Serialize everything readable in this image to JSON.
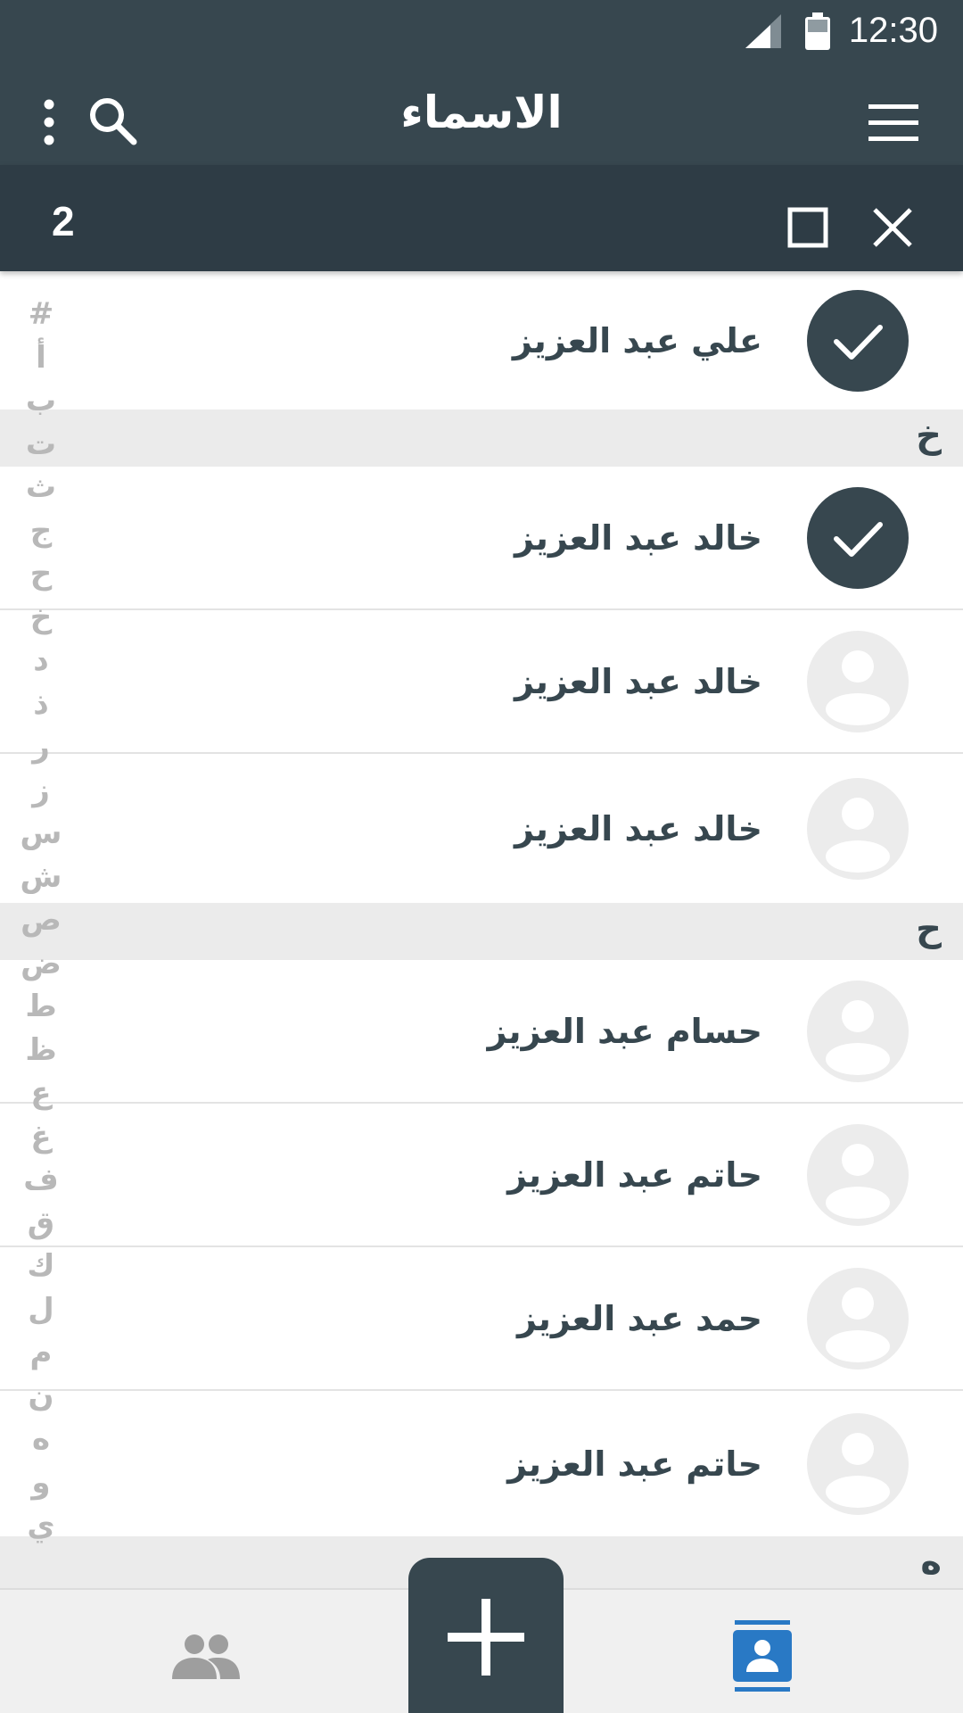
{
  "status_bar": {
    "time": "12:30"
  },
  "app_bar": {
    "title": "الاسماء"
  },
  "selection": {
    "count": "2"
  },
  "sections": [
    {
      "letter": "خ"
    },
    {
      "letter": "ح"
    },
    {
      "letter": "ه"
    }
  ],
  "contacts": [
    {
      "name": "علي عبد العزيز",
      "selected": true
    },
    {
      "name": "خالد عبد العزيز",
      "selected": true
    },
    {
      "name": "خالد عبد العزيز",
      "selected": false
    },
    {
      "name": "خالد عبد العزيز",
      "selected": false
    },
    {
      "name": "حسام عبد العزيز",
      "selected": false
    },
    {
      "name": "حاتم عبد العزيز",
      "selected": false
    },
    {
      "name": "حمد عبد العزيز",
      "selected": false
    },
    {
      "name": "حاتم عبد العزيز",
      "selected": false
    }
  ],
  "index_letters": [
    "#",
    "أ",
    "ب",
    "ت",
    "ث",
    "ج",
    "ح",
    "خ",
    "د",
    "ذ",
    "ر",
    "ز",
    "س",
    "ش",
    "ص",
    "ض",
    "ط",
    "ظ",
    "ع",
    "غ",
    "ف",
    "ق",
    "ك",
    "ل",
    "م",
    "ن",
    "ه",
    "و",
    "ي"
  ],
  "icons": {
    "overflow": "more-vert-icon",
    "search": "search-icon",
    "menu": "hamburger-menu-icon",
    "select_all": "checkbox-outline-icon",
    "close": "close-icon",
    "groups": "groups-icon",
    "add": "plus-icon",
    "contacts": "contacts-icon"
  },
  "colors": {
    "app_bar": "#37474f",
    "selection_bar": "#2e3c45",
    "section_header": "#ebebeb",
    "active_tab": "#2979c5",
    "inactive_tab": "#9e9e9e",
    "index_letter": "#b8b8b8"
  }
}
